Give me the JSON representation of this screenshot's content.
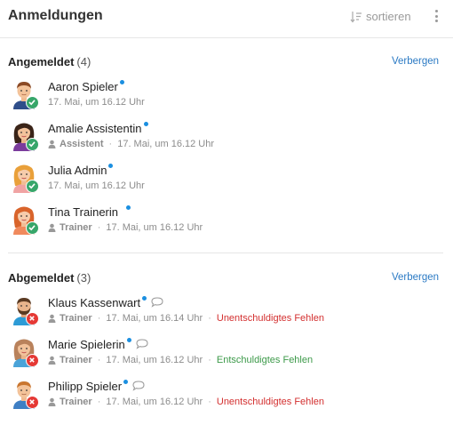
{
  "header": {
    "title": "Anmeldungen",
    "sort_label": "sortieren"
  },
  "colors": {
    "accent_link": "#2b7ac4",
    "status_ok": "#37a66a",
    "status_no": "#e53935",
    "unexcused": "#d32f2f",
    "excused": "#3d9a4a",
    "online_dot": "#1b8fe0"
  },
  "registered": {
    "title": "Angemeldet",
    "count": "(4)",
    "hide_label": "Verbergen",
    "people": [
      {
        "name": "Aaron Spieler",
        "role": "",
        "time": "17. Mai, um 16.12 Uhr",
        "avatar": "boy-avatar"
      },
      {
        "name": "Amalie Assistentin",
        "role": "Assistent",
        "time": "17. Mai, um 16.12 Uhr",
        "avatar": "woman-dark-hair-avatar"
      },
      {
        "name": "Julia Admin",
        "role": "",
        "time": "17. Mai, um 16.12 Uhr",
        "avatar": "woman-blonde-avatar"
      },
      {
        "name": "Tina Trainerin",
        "role": "Trainer",
        "time": "17. Mai, um 16.12 Uhr",
        "avatar": "woman-red-hair-avatar"
      }
    ]
  },
  "unregistered": {
    "title": "Abgemeldet",
    "count": "(3)",
    "hide_label": "Verbergen",
    "people": [
      {
        "name": "Klaus Kassenwart",
        "role": "Trainer",
        "time": "17. Mai, um 16.14 Uhr",
        "reason": "Unentschuldigtes Fehlen",
        "avatar": "bearded-man-avatar"
      },
      {
        "name": "Marie Spielerin",
        "role": "Trainer",
        "time": "17. Mai, um 16.12 Uhr",
        "reason": "Entschuldigtes Fehlen",
        "avatar": "woman-brown-hair-avatar"
      },
      {
        "name": "Philipp Spieler",
        "role": "Trainer",
        "time": "17. Mai, um 16.12 Uhr",
        "reason": "Unentschuldigtes Fehlen",
        "avatar": "man-avatar"
      }
    ]
  }
}
